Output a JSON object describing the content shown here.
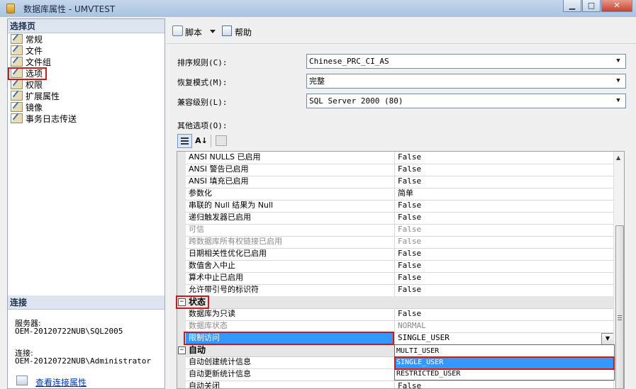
{
  "window": {
    "title": "数据库属性 - UMVTEST",
    "minimize": "▁",
    "maximize": "□",
    "close": "✕"
  },
  "left_panel": {
    "select_page_header": "选择页",
    "items": [
      "常规",
      "文件",
      "文件组",
      "选项",
      "权限",
      "扩展属性",
      "镜像",
      "事务日志传送"
    ],
    "selected_item": "选项",
    "connection_header": "连接",
    "server_label": "服务器:",
    "server_value": "OEM-20120722NUB\\SQL2005",
    "connection_label": "连接:",
    "connection_value": "OEM-20120722NUB\\Administrator",
    "view_connection_link": "查看连接属性"
  },
  "toolbar": {
    "script_label": "脚本",
    "help_label": "帮助"
  },
  "form": {
    "collation_label": "排序规则(C):",
    "collation_value": "Chinese_PRC_CI_AS",
    "recovery_label": "恢复模式(M):",
    "recovery_value": "完整",
    "compat_label": "兼容级别(L):",
    "compat_value": "SQL Server 2000 (80)",
    "other_options_label": "其他选项(O):"
  },
  "property_grid": {
    "rows": [
      {
        "name": "ANSI NULLS 已启用",
        "value": "False",
        "dim": false
      },
      {
        "name": "ANSI 警告已启用",
        "value": "False",
        "dim": false
      },
      {
        "name": "ANSI 填充已启用",
        "value": "False",
        "dim": false
      },
      {
        "name": "参数化",
        "value": "简单",
        "dim": false
      },
      {
        "name": "串联的 Null 结果为 Null",
        "value": "False",
        "dim": false
      },
      {
        "name": "递归触发器已启用",
        "value": "False",
        "dim": false
      },
      {
        "name": "可信",
        "value": "False",
        "dim": true
      },
      {
        "name": "跨数据库所有权链接已启用",
        "value": "False",
        "dim": true
      },
      {
        "name": "日期相关性优化已启用",
        "value": "False",
        "dim": false
      },
      {
        "name": "数值舍入中止",
        "value": "False",
        "dim": false
      },
      {
        "name": "算术中止已启用",
        "value": "False",
        "dim": false
      },
      {
        "name": "允许带引号的标识符",
        "value": "False",
        "dim": false
      }
    ],
    "state_category": "状态",
    "state_rows": [
      {
        "name": "数据库为只读",
        "value": "False",
        "dim": false
      },
      {
        "name": "数据库状态",
        "value": "NORMAL",
        "dim": true
      }
    ],
    "restrict_access_name": "限制访问",
    "restrict_access_value": "SINGLE_USER",
    "auto_category": "自动",
    "auto_rows": [
      {
        "name": "自动创建统计信息",
        "value": "",
        "dim": false
      },
      {
        "name": "自动更新统计信息",
        "value": "",
        "dim": false
      },
      {
        "name": "自动关闭",
        "value": "False",
        "dim": false
      }
    ],
    "dropdown_options": [
      "MULTI_USER",
      "SINGLE_USER",
      "RESTRICTED_USER"
    ],
    "dropdown_selected": "SINGLE_USER"
  },
  "colors": {
    "highlight_red": "#d01818",
    "selection_blue": "#3399ff"
  }
}
